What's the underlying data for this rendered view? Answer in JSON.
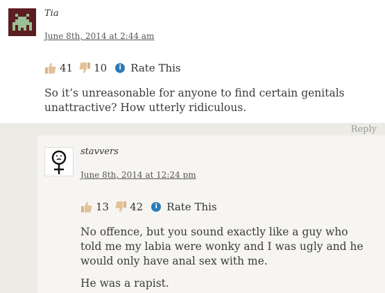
{
  "comments": [
    {
      "author": "Tia",
      "date": "June 8th, 2014 at 2:44 am",
      "likes": "41",
      "dislikes": "10",
      "rate_label": "Rate This",
      "body": [
        "So it’s unreasonable for anyone to find certain genitals unattractive? How utterly ridiculous."
      ],
      "reply_label": "Reply"
    },
    {
      "author": "stavvers",
      "date": "June 8th, 2014 at 12:24 pm",
      "likes": "13",
      "dislikes": "42",
      "rate_label": "Rate This",
      "body": [
        "No offence, but you sound exactly like a guy who told me my labia were wonky and I was ugly and he would only have anal sex with me.",
        "He was a rapist."
      ]
    }
  ],
  "icons": {
    "like": "thumbs-up-icon",
    "dislike": "thumbs-down-icon",
    "info": "info-icon",
    "avatar_tia": "space-invader-avatar-icon",
    "avatar_stavvers": "female-symbol-avatar-icon"
  }
}
